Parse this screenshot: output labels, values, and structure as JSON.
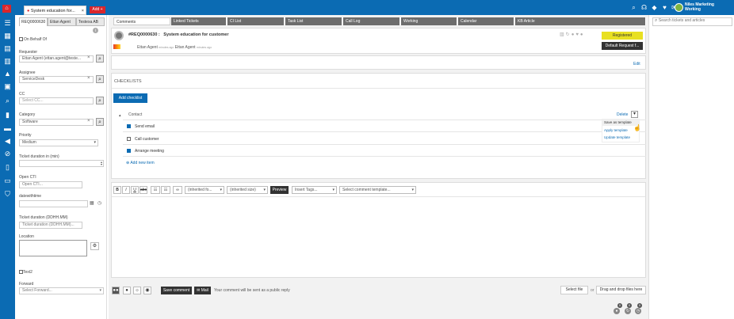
{
  "topbar": {
    "ticket_tab": "System education for...",
    "add_label": "Add +",
    "user_name": "Niles Marketing",
    "user_status": "Working"
  },
  "left": {
    "tabs": [
      "REQ0000630",
      "Ettan Agent",
      "Testexa AB"
    ],
    "on_behalf": "On Behalf Of",
    "requester_label": "Requester",
    "requester_value": "Ettan Agent (ettan.agent@teste...",
    "assignee_label": "Assignee",
    "assignee_value": "ServiceDesk",
    "cc_label": "CC",
    "cc_placeholder": "Select CC...",
    "category_label": "Category",
    "category_value": "Software",
    "priority_label": "Priority",
    "priority_value": "Medium",
    "duration_min_label": "Ticket duration in (min)",
    "open_cti_label": "Open CTI",
    "open_cti_placeholder": "Open CTI...",
    "datewithtime_label": "datewithtime",
    "duration_dd_label": "Ticket duration (DDHH.MM)",
    "duration_dd_placeholder": "Ticket duration (DDHH.MM)...",
    "location_label": "Location",
    "text2_label": "Text2",
    "forward_label": "Forward",
    "forward_placeholder": "Select Forward..."
  },
  "main": {
    "tabs": [
      "Comments",
      "Linked Tickets",
      "CI List",
      "Task List",
      "Call Log",
      "Working",
      "Calendar",
      "KB Article"
    ],
    "ticket_id": "#REQ0000630 :",
    "ticket_title": "System education for customer",
    "agent_line_a": "Ettan Agent",
    "agent_line_a_time": "minutes ago",
    "agent_line_b": "Ettan Agent",
    "agent_line_b_time": "minutes ago",
    "status_button": "Registered",
    "request_button": "Default Request f...",
    "edit_link": "Edit",
    "checklists_title": "CHECKLISTS",
    "add_checklist": "Add checklist",
    "contact_label": "Contact",
    "delete_label": "Delete",
    "items": [
      {
        "label": "Send email",
        "checked": true
      },
      {
        "label": "Call customer",
        "checked": false
      },
      {
        "label": "Arrange meeting",
        "checked": true
      }
    ],
    "add_item": "Add new item",
    "menu": [
      "Save as template",
      "Apply template",
      "Update template"
    ]
  },
  "editor": {
    "inherited_font": "(inherited fo...",
    "inherited_size": "(inherited size)",
    "preview": "Preview",
    "insert_tags": "Insert Tags...",
    "comment_template": "Select comment template..."
  },
  "bottom": {
    "save_comment": "Save comment",
    "mail": "Mail",
    "public_note": "Your comment will be sent as a public reply",
    "select_file": "Select file",
    "or": "or",
    "drop_files": "Drag and drop files here",
    "badges": [
      "0",
      "0",
      "0"
    ]
  },
  "right": {
    "search_placeholder": "Search tickets and articles"
  }
}
